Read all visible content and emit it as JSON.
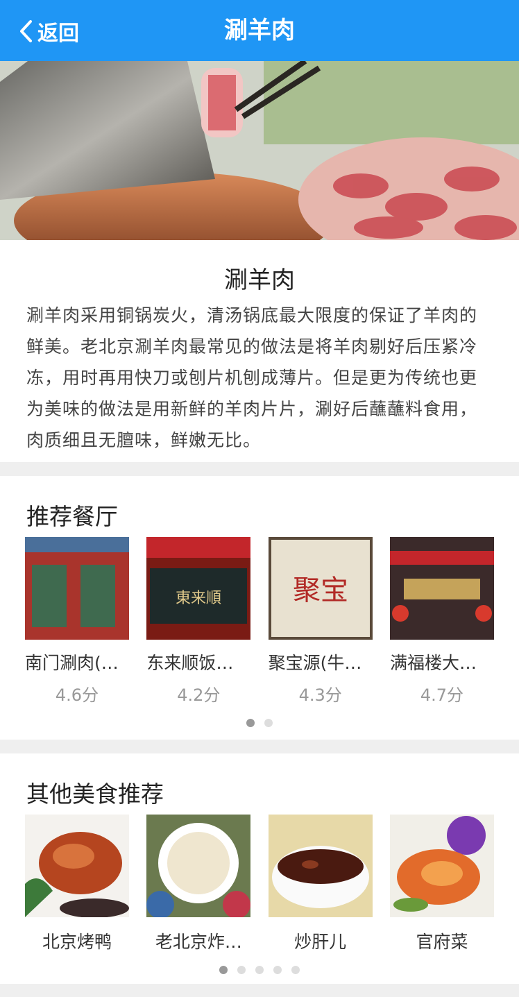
{
  "header": {
    "back_label": "返回",
    "title": "涮羊肉"
  },
  "intro": {
    "title": "涮羊肉",
    "text": "涮羊肉采用铜锅炭火，清汤锅底最大限度的保证了羊肉的鲜美。老北京涮羊肉最常见的做法是将羊肉剔好后压紧冷冻，用时再用快刀或刨片机刨成薄片。但是更为传统也更为美味的做法是用新鲜的羊肉片片，涮好后蘸蘸料食用，肉质细且无膻味，鲜嫩无比。"
  },
  "restaurants": {
    "title": "推荐餐厅",
    "items": [
      {
        "name": "南门涮肉(…",
        "score": "4.6分"
      },
      {
        "name": "东来顺饭…",
        "score": "4.2分"
      },
      {
        "name": "聚宝源(牛…",
        "score": "4.3分"
      },
      {
        "name": "满福楼大…",
        "score": "4.7分"
      }
    ],
    "pages": 2,
    "active_page": 1
  },
  "other_food": {
    "title": "其他美食推荐",
    "items": [
      {
        "name": "北京烤鸭"
      },
      {
        "name": "老北京炸…"
      },
      {
        "name": "炒肝儿"
      },
      {
        "name": "官府菜"
      }
    ],
    "pages": 5,
    "active_page": 1
  },
  "colors": {
    "nav": "#1f96f5",
    "background": "#efefef"
  }
}
